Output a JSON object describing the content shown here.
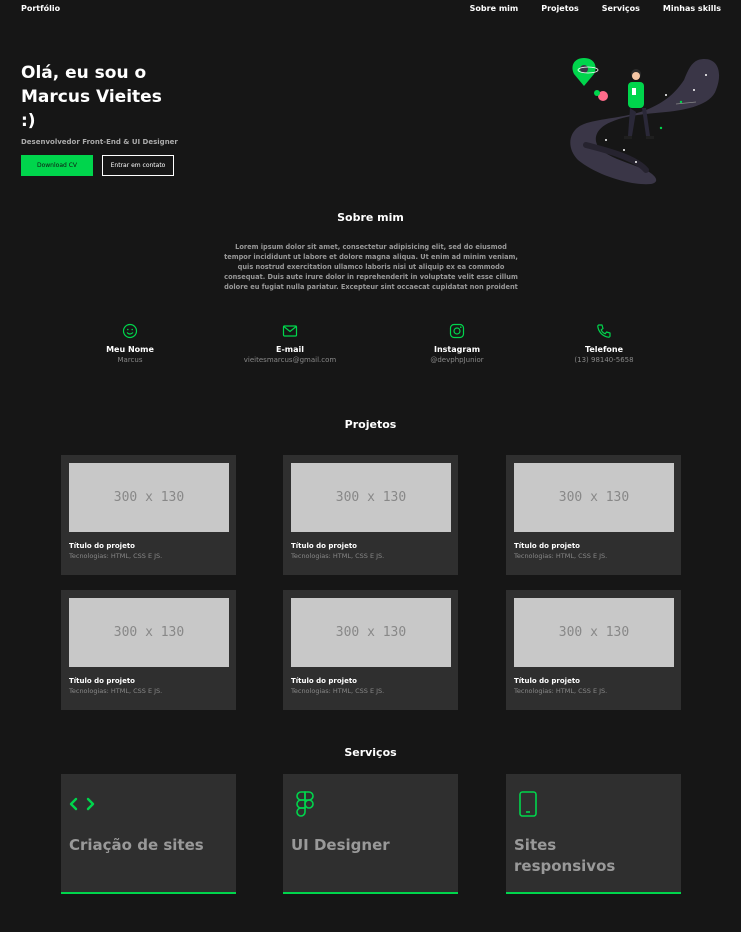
{
  "nav": {
    "brand": "Portfólio",
    "links": [
      "Sobre mim",
      "Projetos",
      "Serviços",
      "Minhas skills"
    ]
  },
  "hero": {
    "title": "Olá, eu sou o Marcus Vieites :)",
    "subtitle": "Desenvolvedor Front-End & UI Designer",
    "download_label": "Download CV",
    "contact_label": "Entrar em contato"
  },
  "about": {
    "title": "Sobre mim",
    "text": "Lorem ipsum dolor sit amet, consectetur adipisicing elit, sed do eiusmod tempor incididunt ut labore et dolore magna aliqua. Ut enim ad minim veniam, quis nostrud exercitation ullamco laboris nisi ut aliquip ex ea commodo consequat. Duis aute irure dolor in reprehenderit in voluptate velit esse cillum dolore eu fugiat nulla pariatur. Excepteur sint occaecat cupidatat non proident",
    "contacts": [
      {
        "icon": "smile-icon",
        "label": "Meu Nome",
        "value": "Marcus"
      },
      {
        "icon": "mail-icon",
        "label": "E-mail",
        "value": "vieitesmarcus@gmail.com"
      },
      {
        "icon": "instagram-icon",
        "label": "Instagram",
        "value": "@devphpJunior"
      },
      {
        "icon": "phone-icon",
        "label": "Telefone",
        "value": "(13) 98140-5658"
      }
    ]
  },
  "projects": {
    "title": "Projetos",
    "items": [
      {
        "thumb": "300 x 130",
        "title": "Título do projeto",
        "tech": "Tecnologias: HTML, CSS E JS."
      },
      {
        "thumb": "300 x 130",
        "title": "Título do projeto",
        "tech": "Tecnologias: HTML, CSS E JS."
      },
      {
        "thumb": "300 x 130",
        "title": "Título do projeto",
        "tech": "Tecnologias: HTML, CSS E JS."
      },
      {
        "thumb": "300 x 130",
        "title": "Título do projeto",
        "tech": "Tecnologias: HTML, CSS E JS."
      },
      {
        "thumb": "300 x 130",
        "title": "Título do projeto",
        "tech": "Tecnologias: HTML, CSS E JS."
      },
      {
        "thumb": "300 x 130",
        "title": "Título do projeto",
        "tech": "Tecnologias: HTML, CSS E JS."
      }
    ]
  },
  "services": {
    "title": "Serviços",
    "items": [
      {
        "icon": "code-icon",
        "label": "Criação de sites"
      },
      {
        "icon": "figma-icon",
        "label": "UI Designer"
      },
      {
        "icon": "smartphone-icon",
        "label": "Sites responsivos"
      }
    ]
  },
  "colors": {
    "background": "#161616",
    "accent": "#00d54c",
    "card": "#2f2f2f"
  }
}
